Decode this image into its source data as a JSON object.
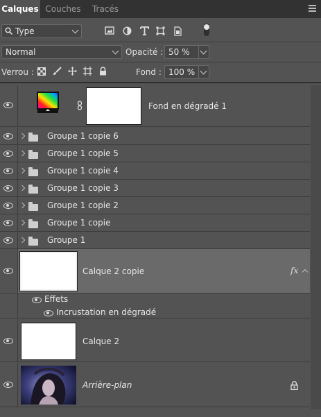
{
  "tabs": [
    {
      "label": "Calques",
      "active": true
    },
    {
      "label": "Couches",
      "active": false
    },
    {
      "label": "Tracés",
      "active": false
    }
  ],
  "filter": {
    "kind_label": "Type"
  },
  "blend": {
    "mode": "Normal",
    "opacity_label": "Opacité :",
    "opacity_value": "50 %"
  },
  "lock": {
    "label": "Verrou :",
    "fill_label": "Fond :",
    "fill_value": "100 %"
  },
  "layers": {
    "fill_layer": {
      "name": "Fond en dégradé 1"
    },
    "groups": [
      {
        "name": "Groupe 1 copie 6"
      },
      {
        "name": "Groupe 1 copie 5"
      },
      {
        "name": "Groupe 1 copie 4"
      },
      {
        "name": "Groupe 1 copie 3"
      },
      {
        "name": "Groupe 1 copie 2"
      },
      {
        "name": "Groupe 1 copie"
      },
      {
        "name": "Groupe 1"
      }
    ],
    "selected_layer": {
      "name": "Calque 2 copie",
      "fx": "fx"
    },
    "effects": {
      "label": "Effets",
      "items": [
        "Incrustation en dégradé"
      ]
    },
    "layer2": {
      "name": "Calque 2"
    },
    "background": {
      "name": "Arrière-plan"
    }
  }
}
